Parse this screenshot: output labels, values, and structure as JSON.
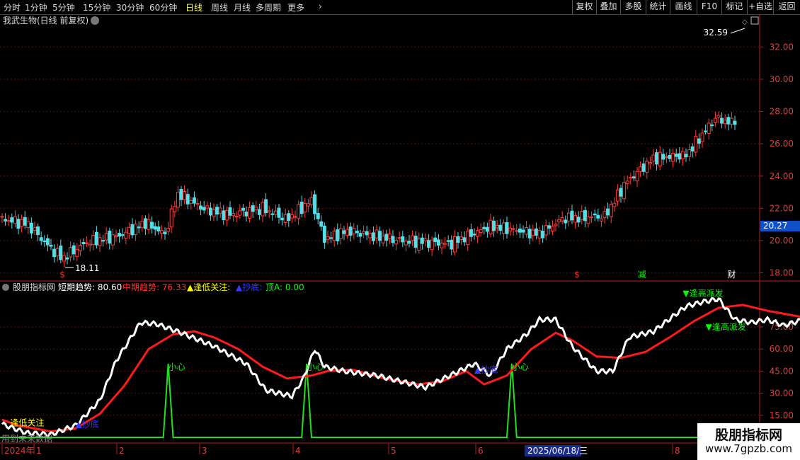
{
  "toolbar": {
    "timeframes": [
      "分时",
      "1分钟",
      "5分钟",
      "15分钟",
      "30分钟",
      "60分钟",
      "日线",
      "周线",
      "月线",
      "多周期",
      "更多"
    ],
    "active_timeframe": "日线",
    "right_buttons": [
      "复权",
      "叠加",
      "多股",
      "统计",
      "画线",
      "F10",
      "标记",
      "+自选",
      "返回"
    ]
  },
  "main_panel": {
    "title": "我武生物(日线 前复权)",
    "high_label": "32.59",
    "low_label": "18.11",
    "current_price": "20.27",
    "markers": [
      {
        "text": "$",
        "color": "#ff3030",
        "bar": 37
      },
      {
        "text": "$",
        "color": "#ff3030",
        "bar": 353
      },
      {
        "text": "减",
        "color": "#00ff00",
        "bar": 393
      },
      {
        "text": "财",
        "color": "#ffffff",
        "bar": 448
      }
    ]
  },
  "indicator_panel": {
    "name": "股朋指标网",
    "short_label": "短期趋势:",
    "short_value": "80.60",
    "mid_label": "中期趋势:",
    "mid_value": "76.33",
    "low_label": "▲逢低关注:",
    "bottom_label": "▲抄底:",
    "top_label": "顶A:",
    "top_value": "0.00",
    "annotations": [
      {
        "text": "逢低关注",
        "color": "#ffff00",
        "bar": 5,
        "value": 8
      },
      {
        "text": "▲抄底",
        "color": "#3a3aff",
        "bar": 45,
        "value": 7
      },
      {
        "text": "小心",
        "color": "#00ff00",
        "bar": 102,
        "value": 46
      },
      {
        "text": "小心",
        "color": "#00ff00",
        "bar": 187,
        "value": 46
      },
      {
        "text": "▲抄底",
        "color": "#3a3aff",
        "bar": 290,
        "value": 44
      },
      {
        "text": "小心",
        "color": "#00ff00",
        "bar": 313,
        "value": 46
      },
      {
        "text": "▼逢高派发",
        "color": "#00ff00",
        "bar": 418,
        "value": 96
      },
      {
        "text": "▼逢高派发",
        "color": "#00ff00",
        "bar": 432,
        "value": 73
      }
    ],
    "footer_note": "用到未来数据"
  },
  "axis": {
    "price_ticks": [
      "32.00",
      "30.00",
      "28.00",
      "26.00",
      "24.00",
      "22.00",
      "20.00",
      "18.00"
    ],
    "indicator_ticks": [
      "75.00",
      "60.00",
      "45.00",
      "30.00",
      "15.00"
    ],
    "date_labels": [
      "2024年",
      "1",
      "2",
      "3",
      "4",
      "5",
      "6",
      "2025/06/18/三",
      "8"
    ]
  },
  "watermark": {
    "line1": "股朋指标网",
    "line2": "www.7gpzb.com"
  },
  "chart_data": {
    "type": "candlestick",
    "title": "我武生物(日线 前复权)",
    "ylim": [
      17.5,
      33.2
    ],
    "segments_close": [
      [
        0,
        21.35
      ],
      [
        16,
        21.0
      ],
      [
        28,
        19.7
      ],
      [
        37,
        18.9
      ],
      [
        52,
        19.9
      ],
      [
        72,
        20.3
      ],
      [
        88,
        21.1
      ],
      [
        100,
        20.4
      ],
      [
        108,
        22.9
      ],
      [
        125,
        21.9
      ],
      [
        140,
        21.6
      ],
      [
        160,
        22.0
      ],
      [
        175,
        21.3
      ],
      [
        190,
        22.5
      ],
      [
        198,
        20.1
      ],
      [
        212,
        20.6
      ],
      [
        245,
        20.0
      ],
      [
        275,
        19.8
      ],
      [
        300,
        20.9
      ],
      [
        330,
        20.4
      ],
      [
        345,
        21.4
      ],
      [
        370,
        21.5
      ],
      [
        383,
        23.6
      ],
      [
        400,
        25.1
      ],
      [
        420,
        25.3
      ],
      [
        438,
        27.6
      ],
      [
        450,
        27.2
      ]
    ],
    "series_short": [
      [
        0,
        9
      ],
      [
        5,
        7
      ],
      [
        15,
        3
      ],
      [
        30,
        2
      ],
      [
        45,
        8
      ],
      [
        60,
        25
      ],
      [
        70,
        52
      ],
      [
        85,
        78
      ],
      [
        95,
        77
      ],
      [
        110,
        71
      ],
      [
        130,
        62
      ],
      [
        150,
        50
      ],
      [
        162,
        32
      ],
      [
        178,
        28
      ],
      [
        185,
        40
      ],
      [
        192,
        60
      ],
      [
        198,
        48
      ],
      [
        210,
        45
      ],
      [
        230,
        42
      ],
      [
        245,
        38
      ],
      [
        260,
        34
      ],
      [
        275,
        42
      ],
      [
        290,
        50
      ],
      [
        300,
        42
      ],
      [
        310,
        60
      ],
      [
        322,
        70
      ],
      [
        330,
        80
      ],
      [
        340,
        80
      ],
      [
        350,
        62
      ],
      [
        365,
        45
      ],
      [
        375,
        45
      ],
      [
        385,
        68
      ],
      [
        400,
        72
      ],
      [
        420,
        89
      ],
      [
        430,
        92
      ],
      [
        440,
        94
      ],
      [
        450,
        80
      ],
      [
        460,
        78
      ],
      [
        470,
        80
      ],
      [
        480,
        76
      ],
      [
        492,
        80
      ],
      [
        500,
        83
      ]
    ],
    "series_mid": [
      [
        0,
        12
      ],
      [
        10,
        8
      ],
      [
        30,
        4
      ],
      [
        45,
        6
      ],
      [
        60,
        16
      ],
      [
        75,
        35
      ],
      [
        90,
        60
      ],
      [
        105,
        70
      ],
      [
        118,
        72
      ],
      [
        130,
        68
      ],
      [
        145,
        60
      ],
      [
        160,
        48
      ],
      [
        175,
        40
      ],
      [
        190,
        42
      ],
      [
        200,
        45
      ],
      [
        215,
        46
      ],
      [
        235,
        40
      ],
      [
        255,
        36
      ],
      [
        270,
        38
      ],
      [
        285,
        45
      ],
      [
        296,
        36
      ],
      [
        310,
        42
      ],
      [
        325,
        60
      ],
      [
        340,
        71
      ],
      [
        350,
        66
      ],
      [
        365,
        55
      ],
      [
        380,
        54
      ],
      [
        395,
        58
      ],
      [
        410,
        68
      ],
      [
        425,
        79
      ],
      [
        440,
        88
      ],
      [
        455,
        90
      ],
      [
        470,
        86
      ],
      [
        490,
        82
      ],
      [
        500,
        80
      ]
    ],
    "series_top_pulses": [
      102,
      187,
      313
    ],
    "indicator_ylim": [
      0,
      100
    ]
  }
}
